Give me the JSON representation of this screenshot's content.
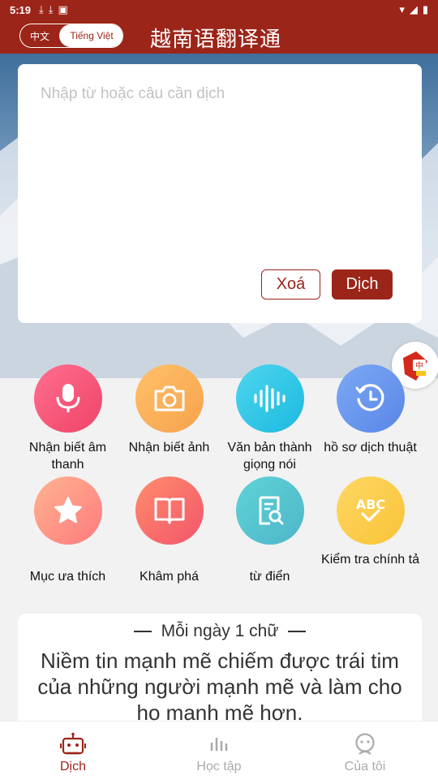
{
  "status_bar": {
    "time": "5:19"
  },
  "header": {
    "lang_zh": "中文",
    "lang_vi": "Tiếng Việt",
    "title": "越南语翻译通"
  },
  "input": {
    "placeholder": "Nhập từ hoặc câu cần dịch",
    "value": ""
  },
  "buttons": {
    "clear": "Xoá",
    "translate": "Dịch"
  },
  "features": {
    "voice_recognition": "Nhận biết âm thanh",
    "image_recognition": "Nhận biết ảnh",
    "text_to_speech": "Văn bản thành giọng nói",
    "history": "hồ sơ dịch thuật",
    "favorites": "Mục ưa thích",
    "explore": "Khâm phá",
    "dictionary": "từ điển",
    "spell_check": "Kiểm tra chính tả"
  },
  "daily": {
    "title": "Mỗi ngày 1 chữ",
    "text": "Niềm tin mạnh mẽ chiếm được trái tim của những người mạnh mẽ và làm cho họ mạnh mẽ hơn."
  },
  "nav": {
    "translate": "Dịch",
    "study": "Học tập",
    "mine": "Của tôi"
  },
  "colors": {
    "brand": "#9c2519",
    "inactive": "#aaaaaa"
  }
}
